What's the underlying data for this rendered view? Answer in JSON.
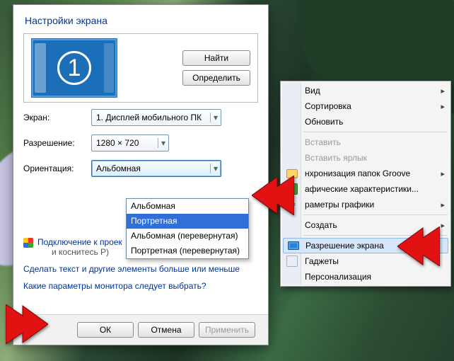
{
  "dialog": {
    "title": "Настройки экрана",
    "find_btn": "Найти",
    "detect_btn": "Определить",
    "monitor_number": "1",
    "screen_lbl": "Экран:",
    "screen_val": "1. Дисплей мобильного ПК",
    "res_lbl": "Разрешение:",
    "res_val": "1280 × 720",
    "orient_lbl": "Ориентация:",
    "orient_val": "Альбомная",
    "orient_options": [
      "Альбомная",
      "Портретная",
      "Альбомная (перевернутая)",
      "Портретная (перевернутая)"
    ],
    "conn_link": "Подключение к проек",
    "conn_hint": "и коснитесь P)",
    "link_textsize": "Сделать текст и другие элементы больше или меньше",
    "link_which": "Какие параметры монитора следует выбрать?",
    "ok": "ОК",
    "cancel": "Отмена",
    "apply": "Применить"
  },
  "ctx": {
    "view": "Вид",
    "sort": "Сортировка",
    "refresh": "Обновить",
    "paste": "Вставить",
    "paste_shortcut": "Вставить ярлык",
    "groove": "нхронизация папок Groove",
    "gfx_char": "афические характеристики...",
    "gfx_params": "раметры графики",
    "create": "Создать",
    "resolution": "Разрешение экрана",
    "gadgets": "Гаджеты",
    "personalize": "Персонализация"
  }
}
